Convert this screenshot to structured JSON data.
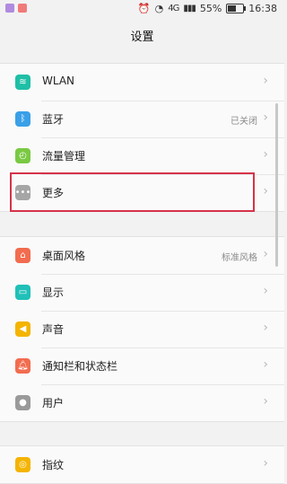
{
  "status_bar": {
    "network": "4G",
    "battery_percent": "55%",
    "battery_level": 0.55,
    "time": "16:38"
  },
  "header": {
    "title": "设置"
  },
  "groups": [
    {
      "items": [
        {
          "label": "WLAN",
          "value": "",
          "icon": "wifi-icon",
          "color": "#1fbfa6"
        },
        {
          "label": "蓝牙",
          "value": "已关闭",
          "icon": "bluetooth-icon",
          "color": "#3aa0e8"
        },
        {
          "label": "流量管理",
          "value": "",
          "icon": "data-usage-icon",
          "color": "#7ac943"
        },
        {
          "label": "更多",
          "value": "",
          "icon": "more-icon",
          "color": "#a6a6a6"
        }
      ]
    },
    {
      "items": [
        {
          "label": "桌面风格",
          "value": "标准风格",
          "icon": "home-icon",
          "color": "#f26c4f"
        },
        {
          "label": "显示",
          "value": "",
          "icon": "display-icon",
          "color": "#20c0b8"
        },
        {
          "label": "声音",
          "value": "",
          "icon": "sound-icon",
          "color": "#f4b400"
        },
        {
          "label": "通知栏和状态栏",
          "value": "",
          "icon": "notification-icon",
          "color": "#f26c4f"
        },
        {
          "label": "用户",
          "value": "",
          "icon": "user-icon",
          "color": "#9a9a9a"
        }
      ]
    },
    {
      "items": [
        {
          "label": "指纹",
          "value": "",
          "icon": "fingerprint-icon",
          "color": "#f4b400"
        }
      ]
    }
  ],
  "annotation": {
    "color": "#d6334a"
  }
}
